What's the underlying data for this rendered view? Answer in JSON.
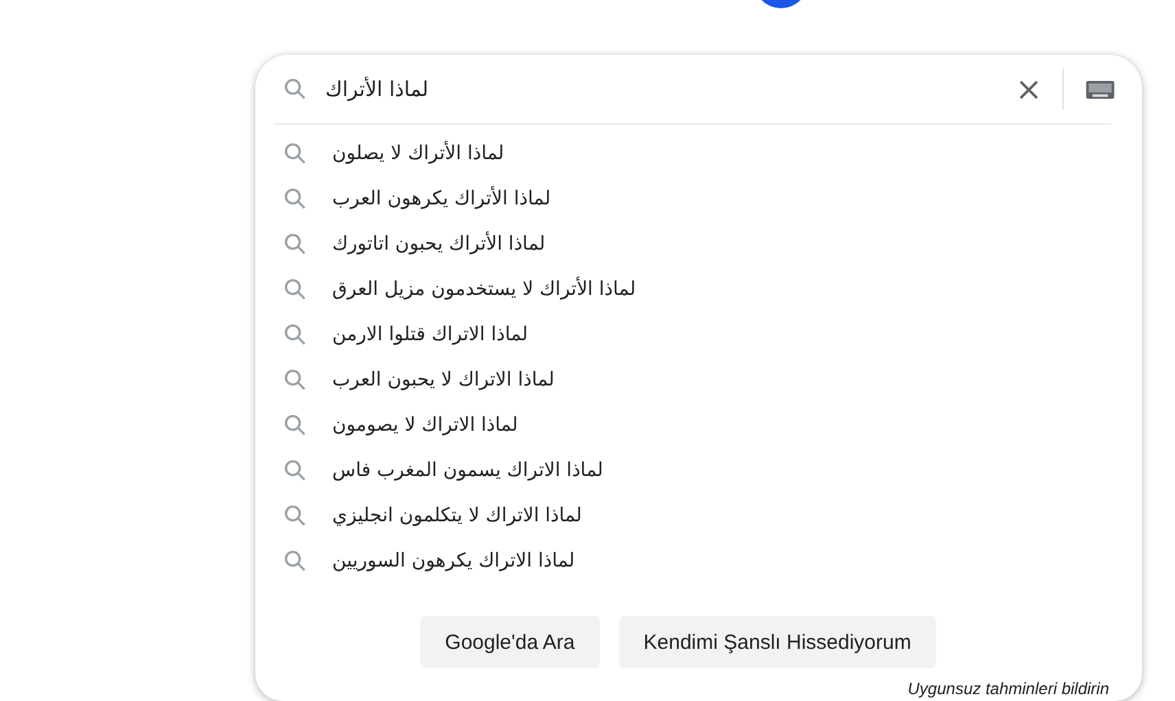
{
  "search": {
    "value": "لماذا الأتراك"
  },
  "suggestions": [
    {
      "text": "لماذا الأتراك لا يصلون"
    },
    {
      "text": "لماذا الأتراك يكرهون العرب"
    },
    {
      "text": "لماذا الأتراك يحبون اتاتورك"
    },
    {
      "text": "لماذا الأتراك لا يستخدمون مزيل العرق"
    },
    {
      "text": "لماذا الاتراك قتلوا الارمن"
    },
    {
      "text": "لماذا الاتراك لا يحبون العرب"
    },
    {
      "text": "لماذا الاتراك لا يصومون"
    },
    {
      "text": "لماذا الاتراك يسمون المغرب فاس"
    },
    {
      "text": "لماذا الاتراك لا يتكلمون انجليزي"
    },
    {
      "text": "لماذا الاتراك يكرهون السوريين"
    }
  ],
  "search_button": "Google'da Ara",
  "lucky_button": "Kendimi Şanslı Hissediyorum",
  "report_link": "Uygunsuz tahminleri bildirin"
}
